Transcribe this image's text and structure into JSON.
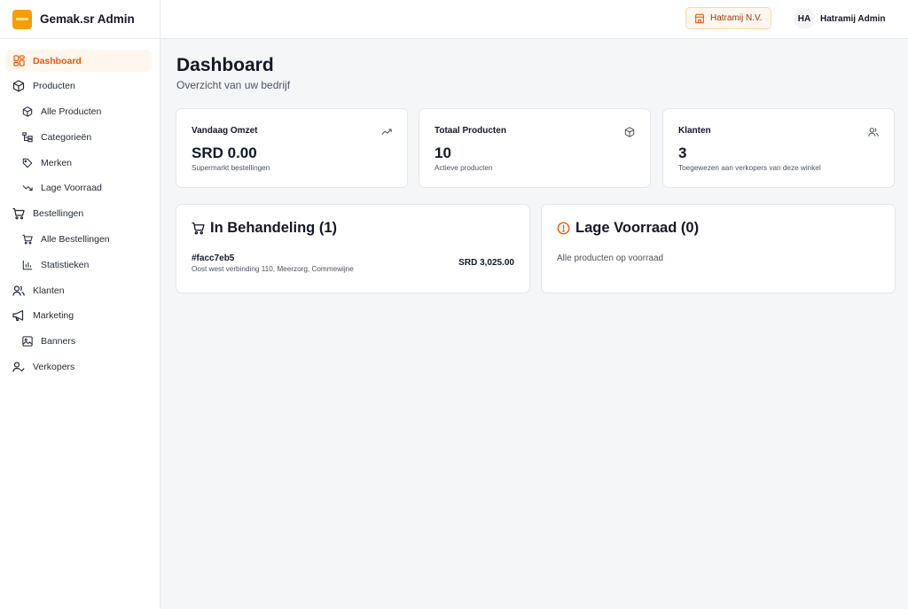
{
  "app": {
    "name": "Gemak.sr Admin"
  },
  "sidebar": {
    "items": [
      {
        "label": "Dashboard",
        "icon": "dashboard-grid-icon",
        "active": true
      },
      {
        "label": "Producten",
        "icon": "box-icon"
      },
      {
        "label": "Alle Producten",
        "icon": "box-icon"
      },
      {
        "label": "Categorieën",
        "icon": "category-tree-icon"
      },
      {
        "label": "Merken",
        "icon": "tag-icon"
      },
      {
        "label": "Lage Voorraad",
        "icon": "trending-down-icon"
      },
      {
        "label": "Bestellingen",
        "icon": "cart-icon"
      },
      {
        "label": "Alle Bestellingen",
        "icon": "cart-icon"
      },
      {
        "label": "Statistieken",
        "icon": "bar-chart-icon"
      },
      {
        "label": "Klanten",
        "icon": "users-icon"
      },
      {
        "label": "Marketing",
        "icon": "megaphone-icon"
      },
      {
        "label": "Banners",
        "icon": "image-icon"
      },
      {
        "label": "Verkopers",
        "icon": "user-check-icon"
      }
    ]
  },
  "header": {
    "store_name": "Hatramij N.V.",
    "store_icon": "store-icon",
    "avatar_initials": "HA",
    "user_name": "Hatramij Admin"
  },
  "page": {
    "title": "Dashboard",
    "subtitle": "Overzicht van uw bedrijf"
  },
  "stats": [
    {
      "title": "Vandaag Omzet",
      "value": "SRD 0.00",
      "description": "Supermarkt bestellingen",
      "icon": "trending-up-icon"
    },
    {
      "title": "Totaal Producten",
      "value": "10",
      "description": "Actieve producten",
      "icon": "box-icon"
    },
    {
      "title": "Klanten",
      "value": "3",
      "description": "Toegewezen aan verkopers van deze winkel",
      "icon": "users-icon"
    }
  ],
  "pending": {
    "title": "In Behandeling (1)",
    "icon": "cart-icon",
    "orders": [
      {
        "id": "#facc7eb5",
        "address": "Oost west verbinding 110, Meerzorg, Commewijne",
        "amount": "SRD 3,025.00"
      }
    ]
  },
  "low_stock": {
    "title": "Lage Voorraad (0)",
    "icon": "alert-circle-icon",
    "message": "Alle producten op voorraad"
  },
  "colors": {
    "accent": "#ea580c",
    "accent_bg": "#fff7ed",
    "logo": "#f59e0b"
  }
}
